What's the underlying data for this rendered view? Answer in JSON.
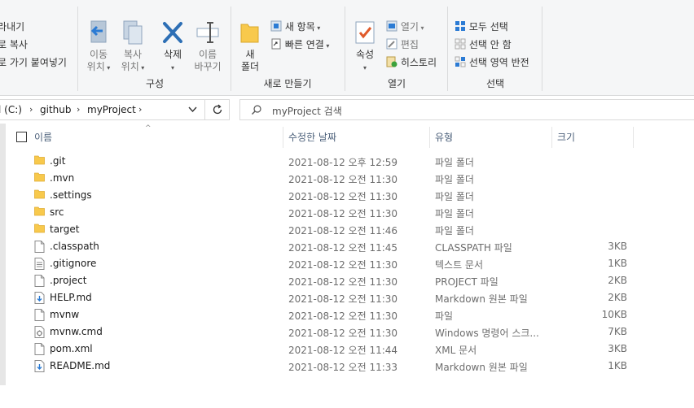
{
  "ribbon": {
    "clipboard": {
      "cut_label": "잘라내기",
      "copy_path_label": "경로 복사",
      "paste_shortcut_label": "바로 가기 붙여넣기"
    },
    "organize": {
      "move_to_line1": "이동",
      "move_to_line2": "위치",
      "copy_to_line1": "복사",
      "copy_to_line2": "위치",
      "delete_label": "삭제",
      "rename_line1": "이름",
      "rename_line2": "바꾸기",
      "group_label": "구성"
    },
    "new": {
      "new_folder_line1": "새",
      "new_folder_line2": "폴더",
      "new_item_label": "새 항목",
      "easy_access_label": "빠른 연결",
      "group_label": "새로 만들기"
    },
    "open": {
      "properties_label": "속성",
      "open_label": "열기",
      "edit_label": "편집",
      "history_label": "히스토리",
      "group_label": "열기"
    },
    "select": {
      "select_all_label": "모두 선택",
      "select_none_label": "선택 안 함",
      "invert_label": "선택 영역 반전",
      "group_label": "선택"
    }
  },
  "address": {
    "crumbs": [
      "l (C:)",
      "github",
      "myProject"
    ],
    "search_placeholder": "myProject 검색"
  },
  "list": {
    "headers": {
      "name": "이름",
      "date": "수정한 날짜",
      "type": "유형",
      "size": "크기"
    },
    "rows": [
      {
        "icon": "folder",
        "name": ".git",
        "date": "2021-08-12 오후 12:59",
        "type": "파일 폴더",
        "size": ""
      },
      {
        "icon": "folder",
        "name": ".mvn",
        "date": "2021-08-12 오전 11:30",
        "type": "파일 폴더",
        "size": ""
      },
      {
        "icon": "folder",
        "name": ".settings",
        "date": "2021-08-12 오전 11:30",
        "type": "파일 폴더",
        "size": ""
      },
      {
        "icon": "folder",
        "name": "src",
        "date": "2021-08-12 오전 11:30",
        "type": "파일 폴더",
        "size": ""
      },
      {
        "icon": "folder",
        "name": "target",
        "date": "2021-08-12 오전 11:46",
        "type": "파일 폴더",
        "size": ""
      },
      {
        "icon": "file",
        "name": ".classpath",
        "date": "2021-08-12 오전 11:45",
        "type": "CLASSPATH 파일",
        "size": "3KB"
      },
      {
        "icon": "text",
        "name": ".gitignore",
        "date": "2021-08-12 오전 11:30",
        "type": "텍스트 문서",
        "size": "1KB"
      },
      {
        "icon": "file",
        "name": ".project",
        "date": "2021-08-12 오전 11:30",
        "type": "PROJECT 파일",
        "size": "2KB"
      },
      {
        "icon": "md",
        "name": "HELP.md",
        "date": "2021-08-12 오전 11:30",
        "type": "Markdown 원본 파일",
        "size": "2KB"
      },
      {
        "icon": "file",
        "name": "mvnw",
        "date": "2021-08-12 오전 11:30",
        "type": "파일",
        "size": "10KB"
      },
      {
        "icon": "cmd",
        "name": "mvnw.cmd",
        "date": "2021-08-12 오전 11:30",
        "type": "Windows 명령어 스크...",
        "size": "7KB"
      },
      {
        "icon": "file",
        "name": "pom.xml",
        "date": "2021-08-12 오전 11:44",
        "type": "XML 문서",
        "size": "3KB"
      },
      {
        "icon": "md",
        "name": "README.md",
        "date": "2021-08-12 오전 11:33",
        "type": "Markdown 원본 파일",
        "size": "1KB"
      }
    ]
  },
  "colors": {
    "folder": "#f8c94c",
    "accent_blue": "#2b7bd4",
    "delete_blue": "#2d6fb5",
    "check_red": "#e05a2a"
  }
}
